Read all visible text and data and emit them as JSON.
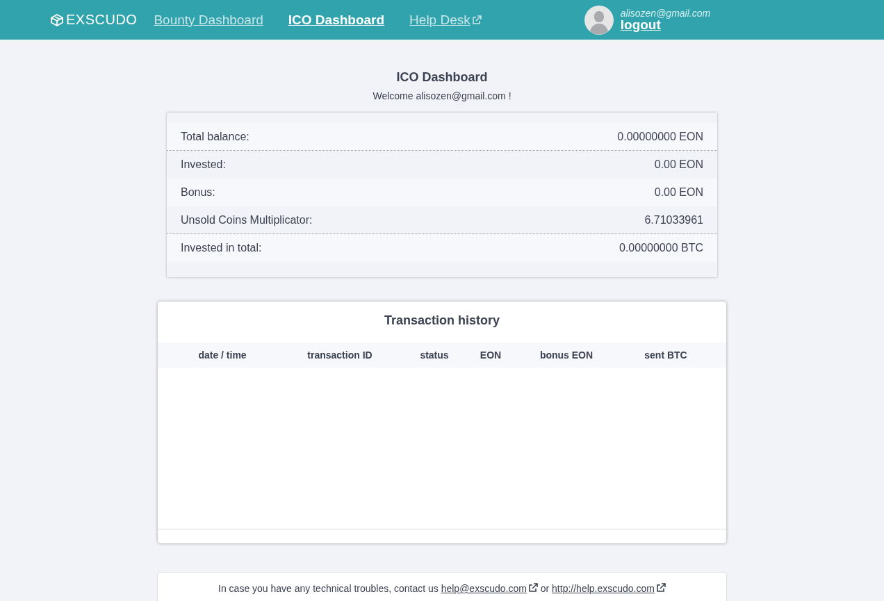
{
  "header": {
    "logo": "EXSCUDO",
    "nav": [
      {
        "label": "Bounty Dashboard",
        "selected": false,
        "external": false
      },
      {
        "label": "ICO Dashboard",
        "selected": true,
        "external": false
      },
      {
        "label": "Help Desk",
        "selected": false,
        "external": true
      }
    ],
    "user": {
      "email": "alisozen@gmail.com",
      "logout": "logout"
    }
  },
  "page": {
    "title": "ICO Dashboard",
    "welcome": "Welcome alisozen@gmail.com !"
  },
  "summary": [
    {
      "label": "Total balance:",
      "value": "0.00000000 EON"
    },
    {
      "label": "Invested:",
      "value": "0.00 EON"
    },
    {
      "label": "Bonus:",
      "value": "0.00 EON"
    },
    {
      "label": "Unsold Coins Multiplicator:",
      "value": "6.71033961"
    },
    {
      "label": "Invested in total:",
      "value": "0.00000000 BTC"
    }
  ],
  "transactions": {
    "title": "Transaction history",
    "columns": [
      "date / time",
      "transaction ID",
      "status",
      "EON",
      "bonus EON",
      "sent BTC"
    ]
  },
  "footer": {
    "text": "In case you have any technical troubles, contact us",
    "email_link": "help@exscudo.com",
    "joiner": "or",
    "help_link": "http://help.exscudo.com"
  }
}
